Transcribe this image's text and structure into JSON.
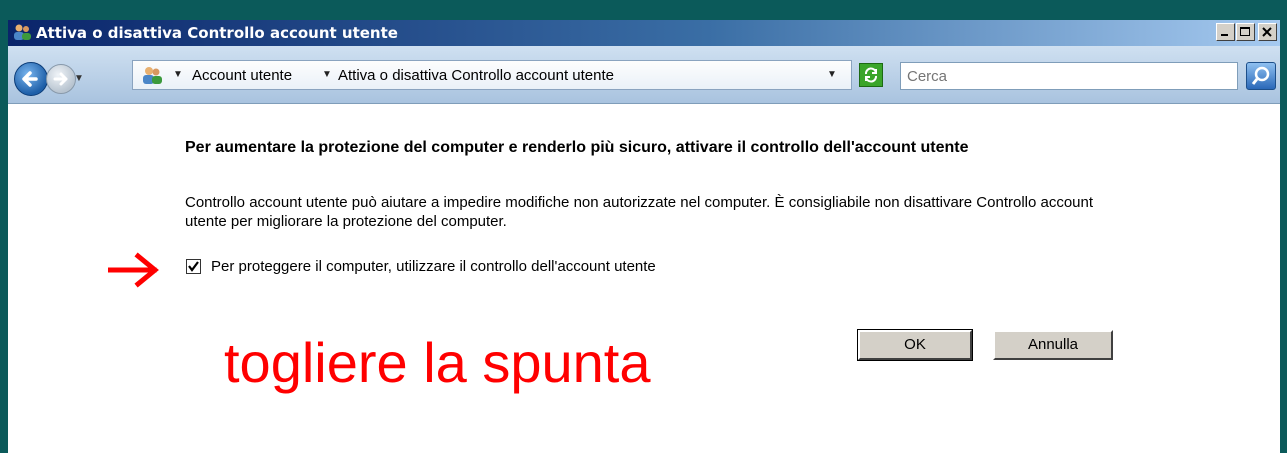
{
  "window": {
    "title": "Attiva o disattiva Controllo account utente"
  },
  "address_bar": {
    "crumbs": [
      "Account utente",
      "Attiva o disattiva Controllo account utente"
    ]
  },
  "search": {
    "placeholder": "Cerca"
  },
  "content": {
    "heading": "Per aumentare la protezione del computer e renderlo più sicuro, attivare il controllo dell'account utente",
    "description": "Controllo account utente può aiutare a impedire modifiche non autorizzate nel computer. È consigliabile non disattivare Controllo account utente per migliorare la protezione del computer.",
    "checkbox_label": "Per proteggere il computer, utilizzare il controllo dell'account utente",
    "checkbox_checked": true,
    "annotation": "togliere la spunta",
    "ok_label": "OK",
    "cancel_label": "Annulla"
  },
  "colors": {
    "annotation": "#ff0000",
    "title_bar": "#0a246a"
  }
}
